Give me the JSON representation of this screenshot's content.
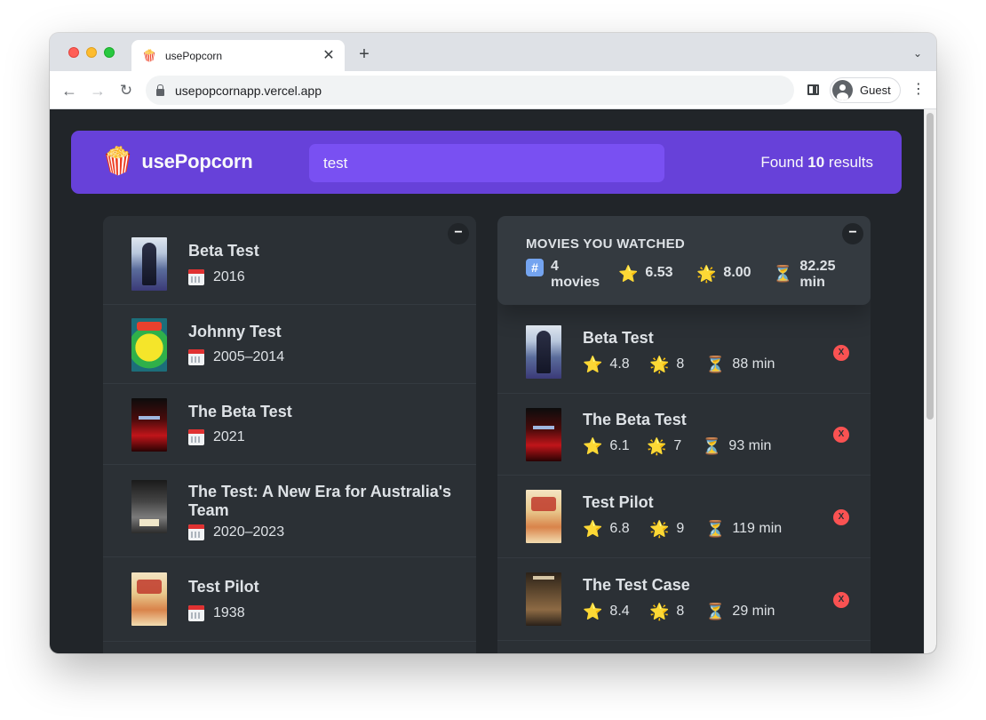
{
  "browser": {
    "tab_title": "usePopcorn",
    "tab_favicon": "🍿",
    "new_tab": "+",
    "url": "usepopcornapp.vercel.app",
    "profile_label": "Guest"
  },
  "navbar": {
    "logo_icon": "🍿",
    "logo_text": "usePopcorn",
    "search_value": "test",
    "results_prefix": "Found",
    "results_count": "10",
    "results_suffix": "results"
  },
  "search_results": {
    "toggle": "−",
    "items": [
      {
        "title": "Beta Test",
        "year": "2016",
        "poster_icon": "beta-test-poster"
      },
      {
        "title": "Johnny Test",
        "year": "2005–2014",
        "poster_icon": "johnny-test-poster"
      },
      {
        "title": "The Beta Test",
        "year": "2021",
        "poster_icon": "the-beta-test-poster"
      },
      {
        "title": "The Test: A New Era for Australia's Team",
        "year": "2020–2023",
        "poster_icon": "the-test-poster"
      },
      {
        "title": "Test Pilot",
        "year": "1938",
        "poster_icon": "test-pilot-poster"
      }
    ]
  },
  "watched": {
    "toggle": "−",
    "summary": {
      "title": "MOVIES YOU WATCHED",
      "count_icon": "#️⃣",
      "count_num": "4",
      "count_label": "movies",
      "imdb_icon": "⭐️",
      "imdb_avg": "6.53",
      "user_icon": "🌟",
      "user_avg": "8.00",
      "runtime_icon": "⏳",
      "runtime_num": "82.25",
      "runtime_unit": "min"
    },
    "items": [
      {
        "title": "Beta Test",
        "imdb": "4.8",
        "user": "8",
        "runtime": "88 min",
        "delete": "X"
      },
      {
        "title": "The Beta Test",
        "imdb": "6.1",
        "user": "7",
        "runtime": "93 min",
        "delete": "X"
      },
      {
        "title": "Test Pilot",
        "imdb": "6.8",
        "user": "9",
        "runtime": "119 min",
        "delete": "X"
      },
      {
        "title": "The Test Case",
        "imdb": "8.4",
        "user": "8",
        "runtime": "29 min",
        "delete": "X"
      }
    ],
    "star_icon": "⭐️",
    "user_star_icon": "🌟",
    "hourglass_icon": "⏳"
  },
  "colors": {
    "primary": "#6741d9",
    "primary_light": "#7950f2",
    "background": "#212529",
    "box": "#2b3035",
    "delete": "#fa5252"
  }
}
